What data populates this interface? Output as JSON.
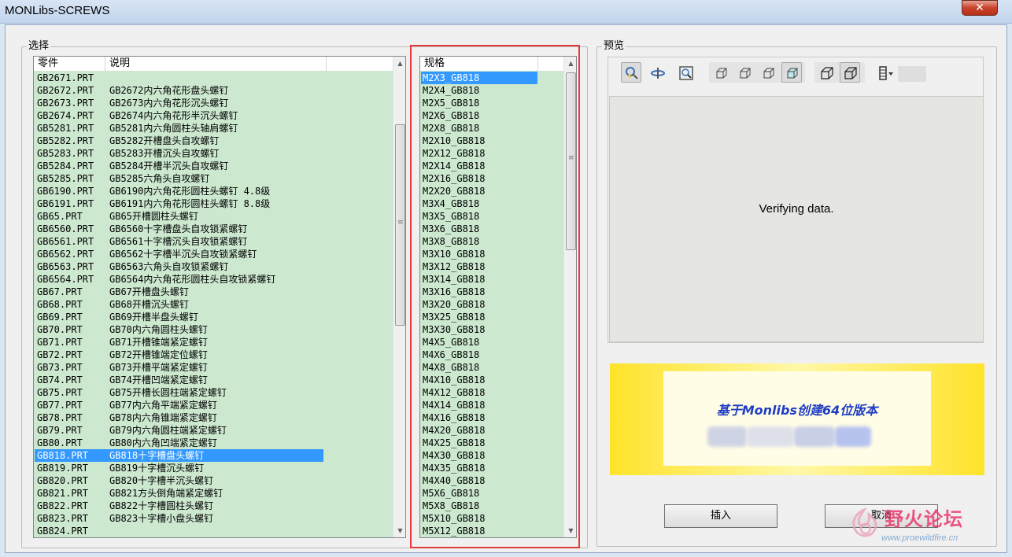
{
  "window": {
    "title": "MONLibs-SCREWS",
    "close_glyph": "✕"
  },
  "select_group": {
    "title": "选择"
  },
  "parts_list": {
    "columns": [
      "零件",
      "说明"
    ],
    "rows": [
      [
        "GB2671.PRT",
        ""
      ],
      [
        "GB2672.PRT",
        "GB2672内六角花形盘头螺钉"
      ],
      [
        "GB2673.PRT",
        "GB2673内六角花形沉头螺钉"
      ],
      [
        "GB2674.PRT",
        "GB2674内六角花形半沉头螺钉"
      ],
      [
        "GB5281.PRT",
        "GB5281内六角圆柱头轴肩螺钉"
      ],
      [
        "GB5282.PRT",
        "GB5282开槽盘头自攻螺钉"
      ],
      [
        "GB5283.PRT",
        "GB5283开槽沉头自攻螺钉"
      ],
      [
        "GB5284.PRT",
        "GB5284开槽半沉头自攻螺钉"
      ],
      [
        "GB5285.PRT",
        "GB5285六角头自攻螺钉"
      ],
      [
        "GB6190.PRT",
        "GB6190内六角花形圆柱头螺钉  4.8级"
      ],
      [
        "GB6191.PRT",
        "GB6191内六角花形圆柱头螺钉  8.8级"
      ],
      [
        "GB65.PRT",
        "GB65开槽圆柱头螺钉"
      ],
      [
        "GB6560.PRT",
        "GB6560十字槽盘头自攻锁紧螺钉"
      ],
      [
        "GB6561.PRT",
        "GB6561十字槽沉头自攻锁紧螺钉"
      ],
      [
        "GB6562.PRT",
        "GB6562十字槽半沉头自攻锁紧螺钉"
      ],
      [
        "GB6563.PRT",
        "GB6563六角头自攻锁紧螺钉"
      ],
      [
        "GB6564.PRT",
        "GB6564内六角花形圆柱头自攻锁紧螺钉"
      ],
      [
        "GB67.PRT",
        "GB67开槽盘头螺钉"
      ],
      [
        "GB68.PRT",
        "GB68开槽沉头螺钉"
      ],
      [
        "GB69.PRT",
        "GB69开槽半盘头螺钉"
      ],
      [
        "GB70.PRT",
        "GB70内六角圆柱头螺钉"
      ],
      [
        "GB71.PRT",
        "GB71开槽锥端紧定螺钉"
      ],
      [
        "GB72.PRT",
        "GB72开槽锥端定位螺钉"
      ],
      [
        "GB73.PRT",
        "GB73开槽平端紧定螺钉"
      ],
      [
        "GB74.PRT",
        "GB74开槽凹端紧定螺钉"
      ],
      [
        "GB75.PRT",
        "GB75开槽长圆柱端紧定螺钉"
      ],
      [
        "GB77.PRT",
        "GB77内六角平端紧定螺钉"
      ],
      [
        "GB78.PRT",
        "GB78内六角锥端紧定螺钉"
      ],
      [
        "GB79.PRT",
        "GB79内六角圆柱端紧定螺钉"
      ],
      [
        "GB80.PRT",
        "GB80内六角凹端紧定螺钉"
      ],
      [
        "GB818.PRT",
        "GB818十字槽盘头螺钉"
      ],
      [
        "GB819.PRT",
        "GB819十字槽沉头螺钉"
      ],
      [
        "GB820.PRT",
        "GB820十字槽半沉头螺钉"
      ],
      [
        "GB821.PRT",
        "GB821方头倒角端紧定螺钉"
      ],
      [
        "GB822.PRT",
        "GB822十字槽圆柱头螺钉"
      ],
      [
        "GB823.PRT",
        "GB823十字槽小盘头螺钉"
      ],
      [
        "GB824.PRT",
        ""
      ]
    ],
    "selected_index": 30
  },
  "spec_list": {
    "column": "规格",
    "rows": [
      "M2X3_GB818",
      "M2X4_GB818",
      "M2X5_GB818",
      "M2X6_GB818",
      "M2X8_GB818",
      "M2X10_GB818",
      "M2X12_GB818",
      "M2X14_GB818",
      "M2X16_GB818",
      "M2X20_GB818",
      "M3X4_GB818",
      "M3X5_GB818",
      "M3X6_GB818",
      "M3X8_GB818",
      "M3X10_GB818",
      "M3X12_GB818",
      "M3X14_GB818",
      "M3X16_GB818",
      "M3X20_GB818",
      "M3X25_GB818",
      "M3X30_GB818",
      "M4X5_GB818",
      "M4X6_GB818",
      "M4X8_GB818",
      "M4X10_GB818",
      "M4X12_GB818",
      "M4X14_GB818",
      "M4X16_GB818",
      "M4X20_GB818",
      "M4X25_GB818",
      "M4X30_GB818",
      "M4X35_GB818",
      "M4X40_GB818",
      "M5X6_GB818",
      "M5X8_GB818",
      "M5X10_GB818",
      "M5X12_GB818"
    ],
    "selected_index": 0
  },
  "preview_group": {
    "title": "预览",
    "status": "Verifying data."
  },
  "banner": {
    "text": "基于Monlibs创建64位版本"
  },
  "buttons": {
    "insert": "插入",
    "cancel": "取消"
  },
  "watermark": {
    "text": "野火论坛",
    "url": "www.proewildfire.cn"
  },
  "colors": {
    "list_bg": "#cce8cf",
    "selection": "#3399ff",
    "highlight_frame": "#e33b3b",
    "banner": "#ffe32a"
  },
  "icons": [
    "select-icon",
    "spin-icon",
    "zoom-fit-icon",
    "wireframe-icon",
    "hidden-line-icon",
    "no-hidden-icon",
    "shaded-icon",
    "display-style-icon",
    "shaded-edges-icon",
    "saved-views-icon"
  ]
}
